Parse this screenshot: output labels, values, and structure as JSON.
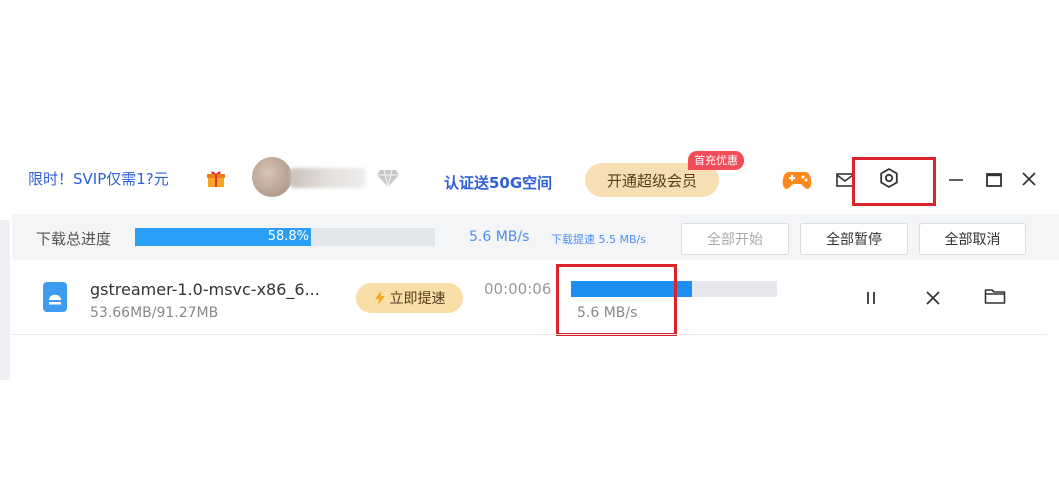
{
  "titlebar": {
    "promo_text": "限时！SVIP仅需1?元",
    "cert_text": "认证送50G空间",
    "vip_button_label": "开通超级会员",
    "vip_badge": "首充优惠",
    "icons": [
      "gift-icon",
      "diamond-icon",
      "game-controller-icon",
      "mail-icon",
      "gear-icon",
      "minimize-icon",
      "maximize-icon",
      "close-icon"
    ]
  },
  "toolbar": {
    "total_label": "下载总进度",
    "total_progress": "58.8%",
    "total_progress_value": 0.588,
    "total_speed": "5.6 MB/s",
    "boost_speed": "下载提速 5.5 MB/s",
    "start_all": "全部开始",
    "pause_all": "全部暂停",
    "cancel_all": "全部取消"
  },
  "tasks": [
    {
      "file_name": "gstreamer-1.0-msvc-x86_6...",
      "size": "53.66MB/91.27MB",
      "boost_label": "立即提速",
      "time_left": "00:00:06",
      "progress_value": 0.588,
      "speed": "5.6 MB/s"
    }
  ],
  "colors": {
    "link_blue": "#2f5fd8",
    "progress_blue": "#2a9df4",
    "vip_gold": "#f6e0b3",
    "highlight_red": "#d9242d",
    "badge_red": "#f24c58"
  }
}
